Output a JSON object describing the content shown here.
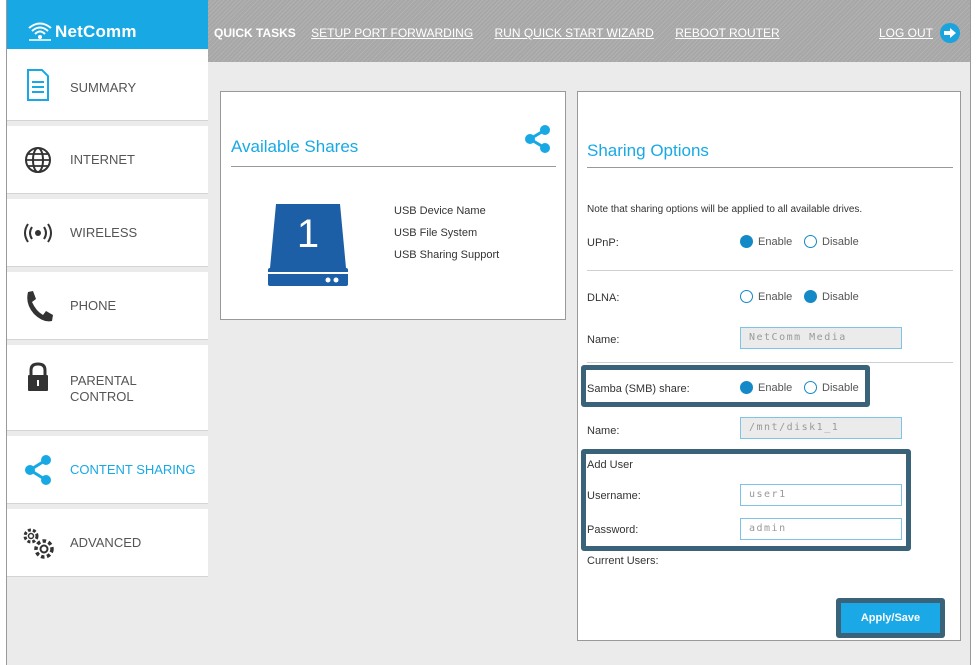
{
  "brand": {
    "name": "NetComm"
  },
  "quick_tasks": {
    "title": "QUICK TASKS",
    "links": [
      "SETUP PORT FORWARDING",
      "RUN QUICK START WIZARD",
      "REBOOT ROUTER"
    ]
  },
  "logout": {
    "label": "LOG OUT"
  },
  "sidebar": {
    "items": [
      {
        "label": "SUMMARY",
        "icon": "document-icon",
        "active": false
      },
      {
        "label": "INTERNET",
        "icon": "globe-icon",
        "active": false
      },
      {
        "label": "WIRELESS",
        "icon": "wireless-icon",
        "active": false
      },
      {
        "label": "PHONE",
        "icon": "phone-icon",
        "active": false
      },
      {
        "label": "PARENTAL",
        "label2": "CONTROL",
        "icon": "lock-icon",
        "active": false
      },
      {
        "label": "CONTENT SHARING",
        "icon": "share-icon",
        "active": true
      },
      {
        "label": "ADVANCED",
        "icon": "gears-icon",
        "active": false
      }
    ]
  },
  "shares": {
    "title": "Available Shares",
    "drive_number": "1",
    "info": [
      "USB Device Name",
      "USB File System",
      "USB Sharing Support"
    ]
  },
  "options": {
    "title": "Sharing Options",
    "note": "Note that sharing options will be applied to all available drives.",
    "upnp": {
      "label": "UPnP:",
      "enable": "Enable",
      "disable": "Disable",
      "selected": "enable"
    },
    "dlna": {
      "label": "DLNA:",
      "enable": "Enable",
      "disable": "Disable",
      "selected": "disable"
    },
    "dlna_name": {
      "label": "Name:",
      "value": "NetComm Media"
    },
    "samba": {
      "label": "Samba (SMB) share:",
      "enable": "Enable",
      "disable": "Disable",
      "selected": "enable"
    },
    "samba_name": {
      "label": "Name:",
      "value": "/mnt/disk1_1"
    },
    "add_user": {
      "label": "Add User"
    },
    "username": {
      "label": "Username:",
      "value": "user1"
    },
    "password": {
      "label": "Password:",
      "value": "admin"
    },
    "current_users": {
      "label": "Current Users:"
    },
    "apply_label": "Apply/Save"
  },
  "colors": {
    "accent": "#18a9e4",
    "highlight": "#3a6279",
    "topbar": "#acacac",
    "drive": "#1c5fa6"
  }
}
